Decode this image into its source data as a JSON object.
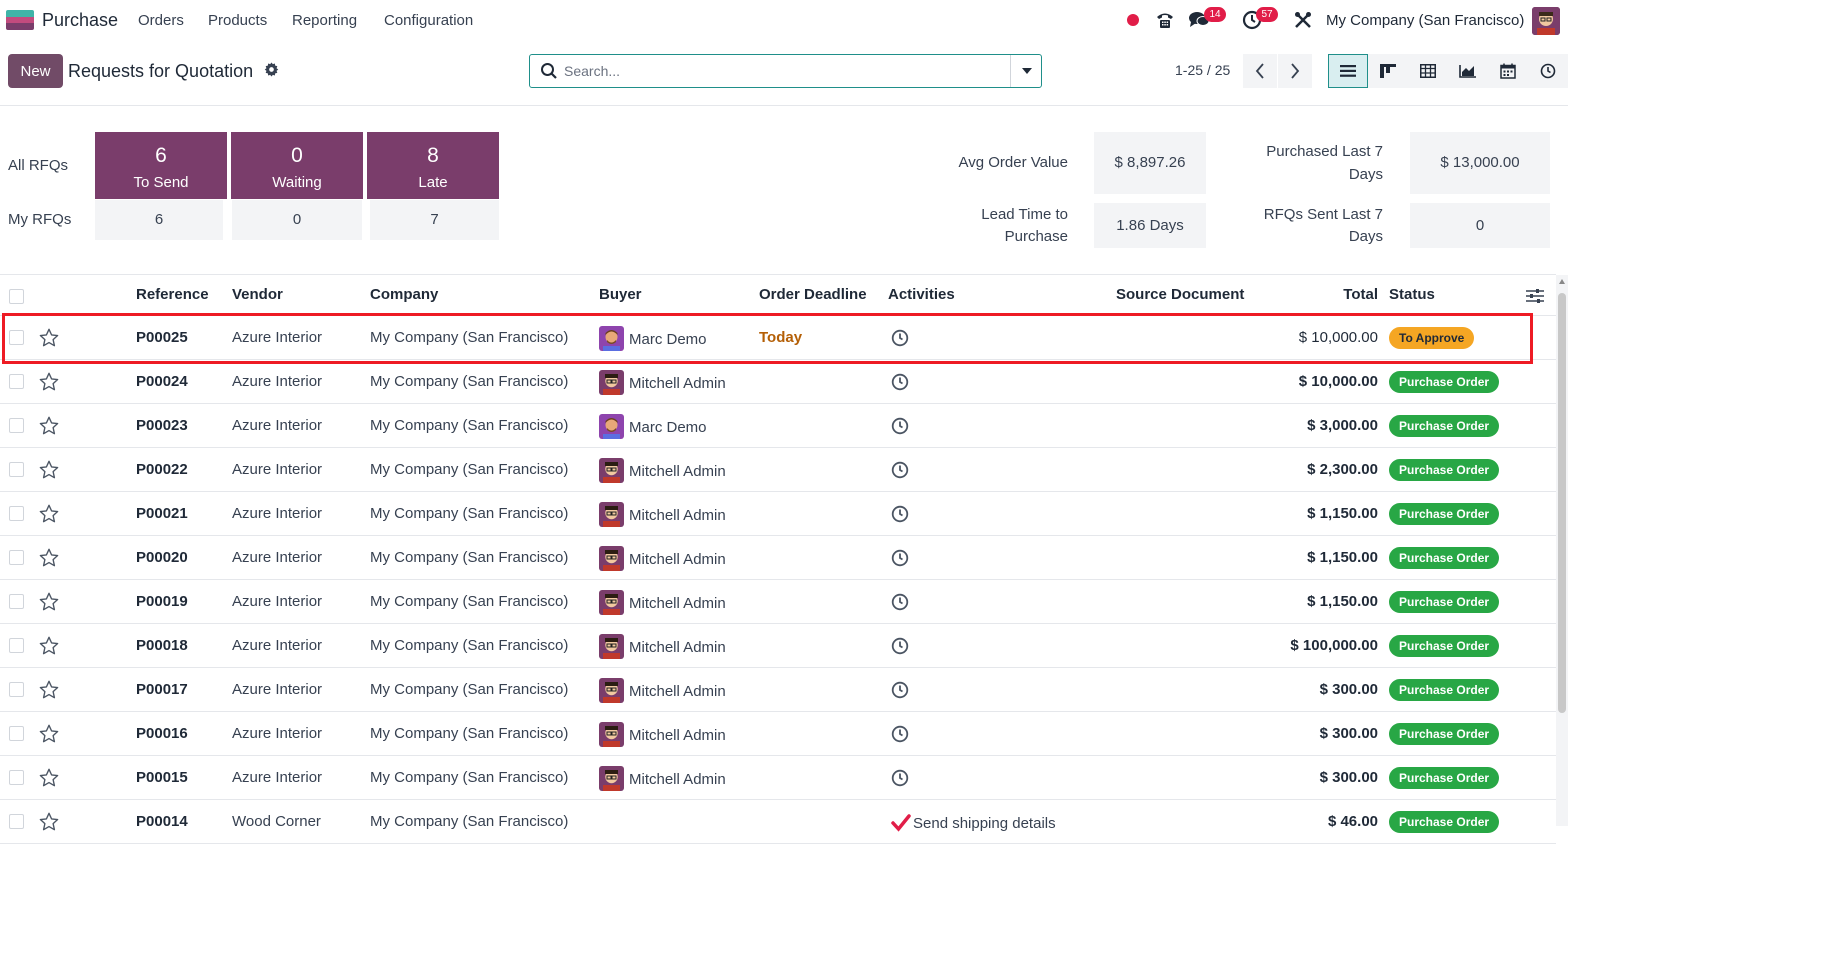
{
  "navbar": {
    "app_name": "Purchase",
    "menu": [
      "Orders",
      "Products",
      "Reporting",
      "Configuration"
    ],
    "messages_count": "14",
    "activities_count": "57",
    "company": "My Company (San Francisco)"
  },
  "control": {
    "new_label": "New",
    "title": "Requests for Quotation",
    "search_placeholder": "Search...",
    "pager": "1-25 / 25",
    "views": [
      "list",
      "kanban",
      "pivot",
      "graph",
      "calendar",
      "activity"
    ]
  },
  "dashboard": {
    "all_rfqs_label": "All RFQs",
    "my_rfqs_label": "My RFQs",
    "tiles": [
      {
        "count": "6",
        "label": "To Send"
      },
      {
        "count": "0",
        "label": "Waiting"
      },
      {
        "count": "8",
        "label": "Late"
      }
    ],
    "my_counts": [
      "6",
      "0",
      "7"
    ],
    "stats": {
      "avg_order_value_label": "Avg Order Value",
      "avg_order_value": "$ 8,897.26",
      "purchased_last7_label_1": "Purchased Last 7",
      "purchased_last7_label_2": "Days",
      "purchased_last7": "$ 13,000.00",
      "lead_time_label_1": "Lead Time to",
      "lead_time_label_2": "Purchase",
      "lead_time": "1.86 Days",
      "rfqs_sent_label_1": "RFQs Sent Last 7",
      "rfqs_sent_label_2": "Days",
      "rfqs_sent": "0"
    }
  },
  "table": {
    "headers": {
      "reference": "Reference",
      "vendor": "Vendor",
      "company": "Company",
      "buyer": "Buyer",
      "deadline": "Order Deadline",
      "activities": "Activities",
      "source": "Source Document",
      "total": "Total",
      "status": "Status"
    },
    "rows": [
      {
        "ref": "P00025",
        "vendor": "Azure Interior",
        "company": "My Company (San Francisco)",
        "buyer": "Marc Demo",
        "deadline": "Today",
        "activity": "",
        "total": "$ 10,000.00",
        "status": "To Approve"
      },
      {
        "ref": "P00024",
        "vendor": "Azure Interior",
        "company": "My Company (San Francisco)",
        "buyer": "Mitchell Admin",
        "deadline": "",
        "activity": "",
        "total": "$ 10,000.00",
        "status": "Purchase Order"
      },
      {
        "ref": "P00023",
        "vendor": "Azure Interior",
        "company": "My Company (San Francisco)",
        "buyer": "Marc Demo",
        "deadline": "",
        "activity": "",
        "total": "$ 3,000.00",
        "status": "Purchase Order"
      },
      {
        "ref": "P00022",
        "vendor": "Azure Interior",
        "company": "My Company (San Francisco)",
        "buyer": "Mitchell Admin",
        "deadline": "",
        "activity": "",
        "total": "$ 2,300.00",
        "status": "Purchase Order"
      },
      {
        "ref": "P00021",
        "vendor": "Azure Interior",
        "company": "My Company (San Francisco)",
        "buyer": "Mitchell Admin",
        "deadline": "",
        "activity": "",
        "total": "$ 1,150.00",
        "status": "Purchase Order"
      },
      {
        "ref": "P00020",
        "vendor": "Azure Interior",
        "company": "My Company (San Francisco)",
        "buyer": "Mitchell Admin",
        "deadline": "",
        "activity": "",
        "total": "$ 1,150.00",
        "status": "Purchase Order"
      },
      {
        "ref": "P00019",
        "vendor": "Azure Interior",
        "company": "My Company (San Francisco)",
        "buyer": "Mitchell Admin",
        "deadline": "",
        "activity": "",
        "total": "$ 1,150.00",
        "status": "Purchase Order"
      },
      {
        "ref": "P00018",
        "vendor": "Azure Interior",
        "company": "My Company (San Francisco)",
        "buyer": "Mitchell Admin",
        "deadline": "",
        "activity": "",
        "total": "$ 100,000.00",
        "status": "Purchase Order"
      },
      {
        "ref": "P00017",
        "vendor": "Azure Interior",
        "company": "My Company (San Francisco)",
        "buyer": "Mitchell Admin",
        "deadline": "",
        "activity": "",
        "total": "$ 300.00",
        "status": "Purchase Order"
      },
      {
        "ref": "P00016",
        "vendor": "Azure Interior",
        "company": "My Company (San Francisco)",
        "buyer": "Mitchell Admin",
        "deadline": "",
        "activity": "",
        "total": "$ 300.00",
        "status": "Purchase Order"
      },
      {
        "ref": "P00015",
        "vendor": "Azure Interior",
        "company": "My Company (San Francisco)",
        "buyer": "Mitchell Admin",
        "deadline": "",
        "activity": "",
        "total": "$ 300.00",
        "status": "Purchase Order"
      },
      {
        "ref": "P00014",
        "vendor": "Wood Corner",
        "company": "My Company (San Francisco)",
        "buyer": "",
        "deadline": "",
        "activity": "Send shipping details",
        "total": "$ 46.00",
        "status": "Purchase Order"
      }
    ]
  },
  "colors": {
    "brand": "#714b67",
    "tile": "#7a3d6b",
    "accent": "#1f8f8a",
    "status_green": "#28a745",
    "status_orange": "#f5a623",
    "badge_red": "#e11d48",
    "highlight_red": "#ee1b24"
  }
}
